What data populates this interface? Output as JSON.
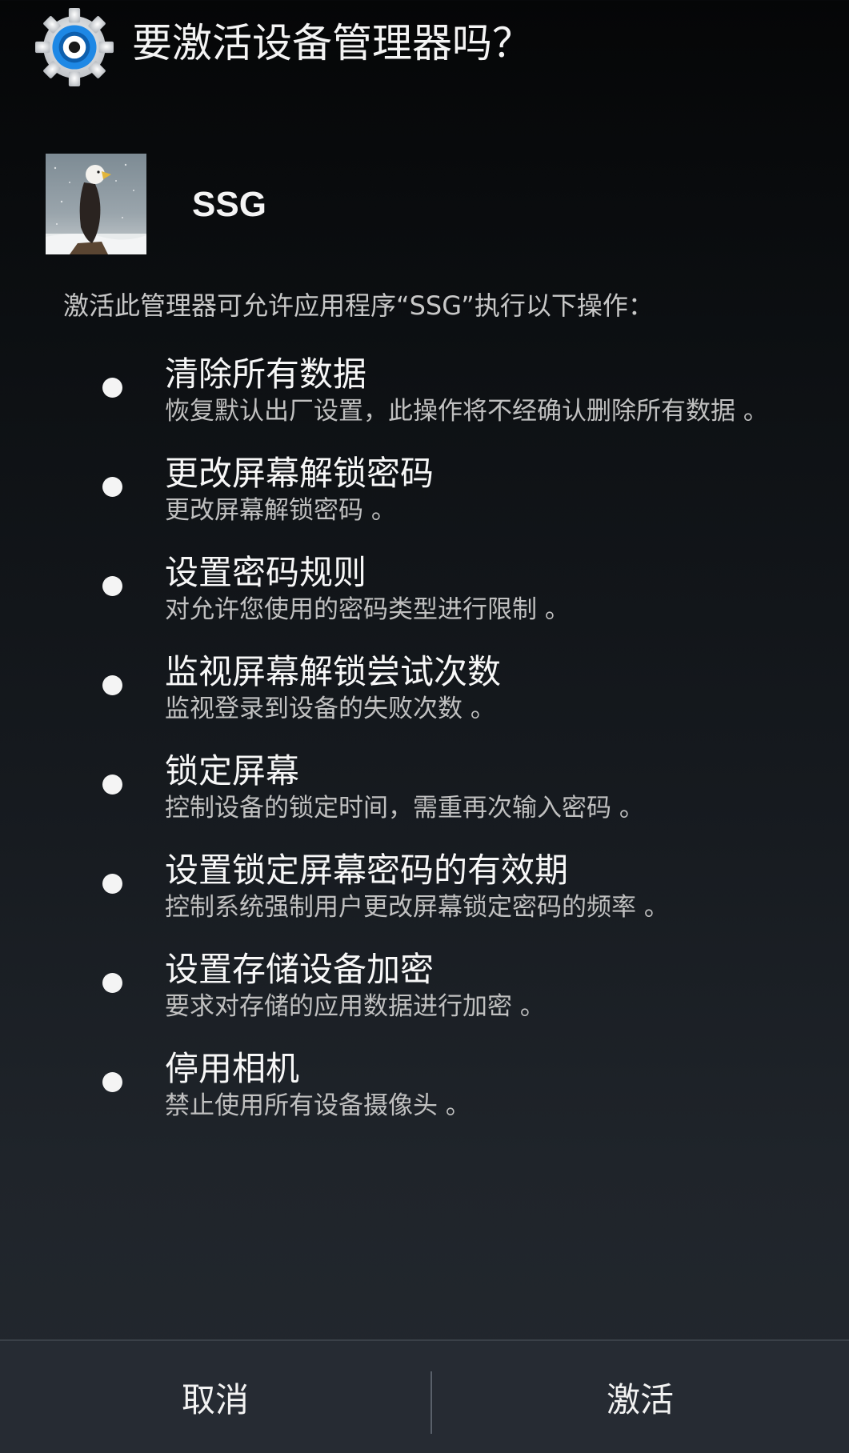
{
  "dialog": {
    "title": "要激活设备管理器吗？",
    "icon": "settings-gear-icon"
  },
  "app": {
    "name": "SSG",
    "icon": "bald-eagle-app-icon"
  },
  "intro": "激活此管理器可允许应用程序“SSG”执行以下操作：",
  "policies": [
    {
      "title": "清除所有数据",
      "desc": "恢复默认出厂设置，此操作将不经确认删除所有数据 。"
    },
    {
      "title": "更改屏幕解锁密码",
      "desc": "更改屏幕解锁密码 。"
    },
    {
      "title": "设置密码规则",
      "desc": "对允许您使用的密码类型进行限制 。"
    },
    {
      "title": "监视屏幕解锁尝试次数",
      "desc": "监视登录到设备的失败次数 。"
    },
    {
      "title": "锁定屏幕",
      "desc": "控制设备的锁定时间，需重再次输入密码 。"
    },
    {
      "title": "设置锁定屏幕密码的有效期",
      "desc": "控制系统强制用户更改屏幕锁定密码的频率 。"
    },
    {
      "title": "设置存储设备加密",
      "desc": "要求对存储的应用数据进行加密 。"
    },
    {
      "title": "停用相机",
      "desc": "禁止使用所有设备摄像头 。"
    }
  ],
  "buttons": {
    "cancel": "取消",
    "activate": "激活"
  },
  "colors": {
    "accent": "#1e88e5",
    "background_top": "#050607",
    "background_bottom": "#23282f"
  }
}
